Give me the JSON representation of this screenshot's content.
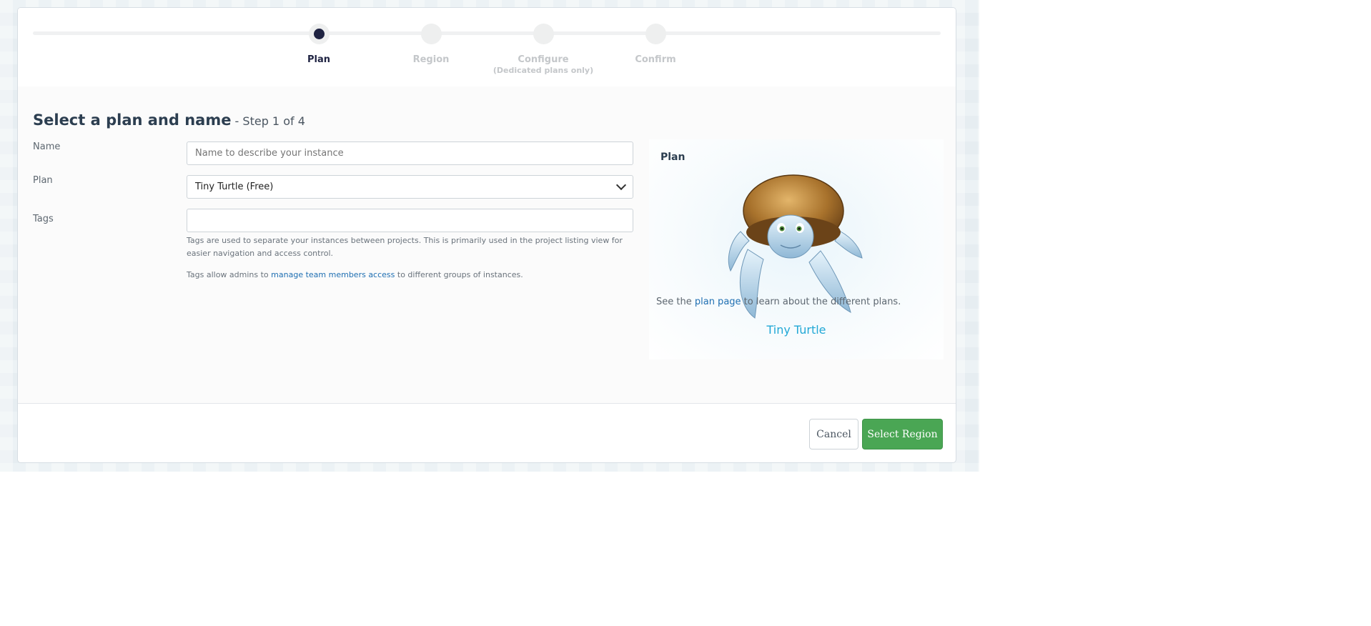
{
  "stepper": {
    "steps": [
      {
        "label": "Plan",
        "sub": "",
        "active": true
      },
      {
        "label": "Region",
        "sub": "",
        "active": false
      },
      {
        "label": "Configure",
        "sub": "(Dedicated plans only)",
        "active": false
      },
      {
        "label": "Confirm",
        "sub": "",
        "active": false
      }
    ]
  },
  "header": {
    "title": "Select a plan and name",
    "step_text": " - Step 1 of 4"
  },
  "form": {
    "name": {
      "label": "Name",
      "placeholder": "Name to describe your instance",
      "value": ""
    },
    "plan": {
      "label": "Plan",
      "value": "Tiny Turtle (Free)"
    },
    "tags": {
      "label": "Tags",
      "value": "",
      "help_1": "Tags are used to separate your instances between projects. This is primarily used in the project listing view for easier navigation and access control.",
      "help_2_prefix": "Tags allow admins to ",
      "help_2_link": "manage team members access",
      "help_2_suffix": " to different groups of instances."
    }
  },
  "plan_panel": {
    "title": "Plan",
    "plan_name": "Tiny Turtle",
    "image_icon": "turtle-mascot",
    "note_prefix": "See the ",
    "note_link": "plan page",
    "note_suffix": " to learn about the different plans."
  },
  "footer": {
    "cancel_label": "Cancel",
    "next_label": "Select Region"
  },
  "colors": {
    "primary_button": "#4aa654",
    "active_step": "#1f2342",
    "link": "#1f6fb2",
    "plan_name": "#22a8d6"
  }
}
